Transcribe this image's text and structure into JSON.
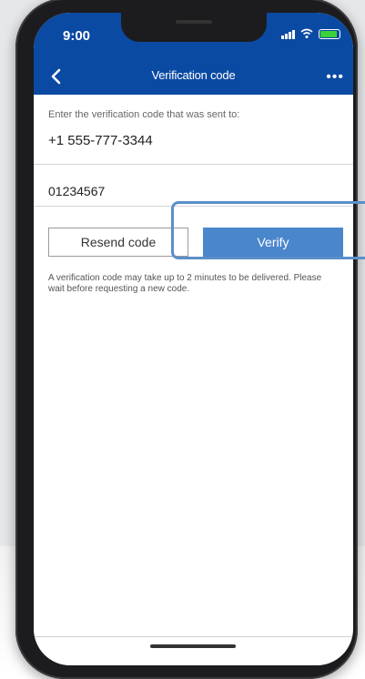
{
  "status_bar": {
    "time": "9:00"
  },
  "nav": {
    "title": "Verification code",
    "more_label": "•••"
  },
  "verification": {
    "prompt": "Enter the verification code that was sent to:",
    "phone_number": "+1 555-777-3344",
    "code_value": "01234567",
    "resend_label": "Resend code",
    "verify_label": "Verify",
    "help_text": "A verification code may take up to 2 minutes to be delivered. Please wait before requesting a new code."
  },
  "colors": {
    "nav_bg": "#0b4aa3",
    "verify_button": "#4a86cc",
    "highlight": "#5b8fc9"
  },
  "icons": [
    "back-chevron-icon",
    "more-icon",
    "signal-icon",
    "wifi-icon",
    "battery-icon"
  ]
}
